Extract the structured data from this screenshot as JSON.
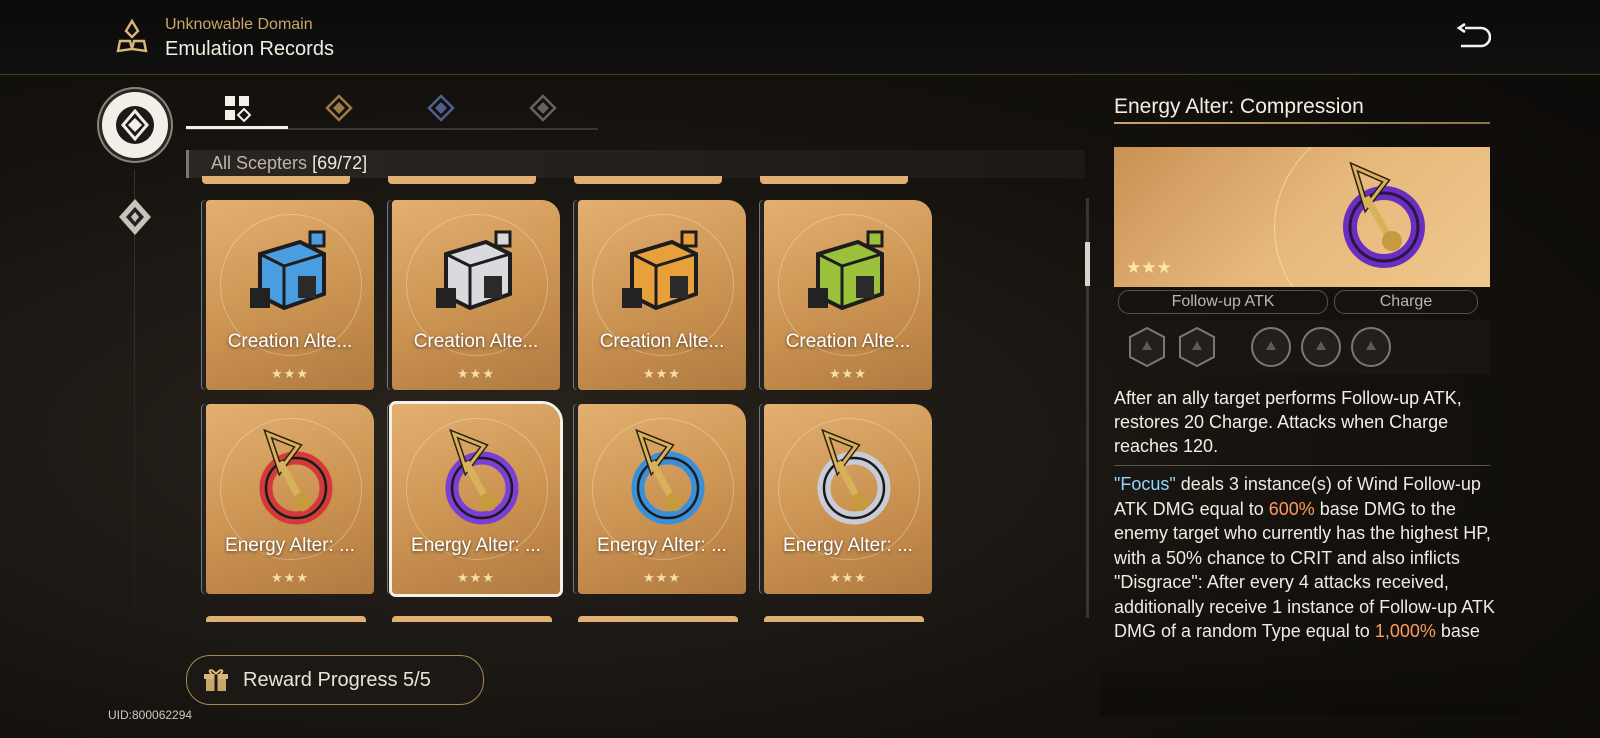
{
  "header": {
    "subtitle": "Unknowable Domain",
    "title": "Emulation Records",
    "logo_icon": "trinity-emblem-icon",
    "back_icon": "return-arrow-icon"
  },
  "side_nav": [
    {
      "icon": "scepter-emblem-icon",
      "active": true
    },
    {
      "icon": "diamond-emblem-icon",
      "active": false
    }
  ],
  "tabs": [
    {
      "icon": "all-grid-icon",
      "active": true
    },
    {
      "icon": "gold-path-icon",
      "active": false
    },
    {
      "icon": "blue-path-icon",
      "active": false
    },
    {
      "icon": "gray-path-icon",
      "active": false
    }
  ],
  "list": {
    "label": "All Scepters",
    "count": "[69/72]"
  },
  "cards": [
    {
      "label": "Creation Alte...",
      "stars": "★★★",
      "color": "#4a9ee0"
    },
    {
      "label": "Creation Alte...",
      "stars": "★★★",
      "color": "#d9d9de"
    },
    {
      "label": "Creation Alte...",
      "stars": "★★★",
      "color": "#e8a13a"
    },
    {
      "label": "Creation Alte...",
      "stars": "★★★",
      "color": "#9bc13a"
    },
    {
      "label": "Energy Alter: ...",
      "stars": "★★★",
      "color": "#d33a3a"
    },
    {
      "label": "Energy Alter: ...",
      "stars": "★★★",
      "color": "#7b3fd6"
    },
    {
      "label": "Energy Alter: ...",
      "stars": "★★★",
      "color": "#3a8fd9"
    },
    {
      "label": "Energy Alter: ...",
      "stars": "★★★",
      "color": "#c9ccd6"
    }
  ],
  "reward": {
    "label": "Reward Progress 5/5",
    "icon": "gift-icon"
  },
  "uid": "UID:800062294",
  "detail": {
    "title": "Energy Alter: Compression",
    "stars": "★★★",
    "tags": [
      "Follow-up ATK",
      "Charge"
    ],
    "summary": "After an ally target performs Follow-up ATK, restores 20 Charge. Attacks when Charge reaches 120.",
    "effect": {
      "quote": "\"Focus\"",
      "part1": " deals 3 instance(s) of Wind Follow-up ATK DMG equal to ",
      "val1": "600%",
      "part2": " base DMG to the enemy target who currently has the highest HP, with a 50% chance to CRIT and also inflicts \"Disgrace\": After every 4 attacks received, additionally receive 1 instance of Follow-up ATK DMG of a random Type equal to ",
      "val2": "1,000%",
      "part3": " base"
    }
  }
}
